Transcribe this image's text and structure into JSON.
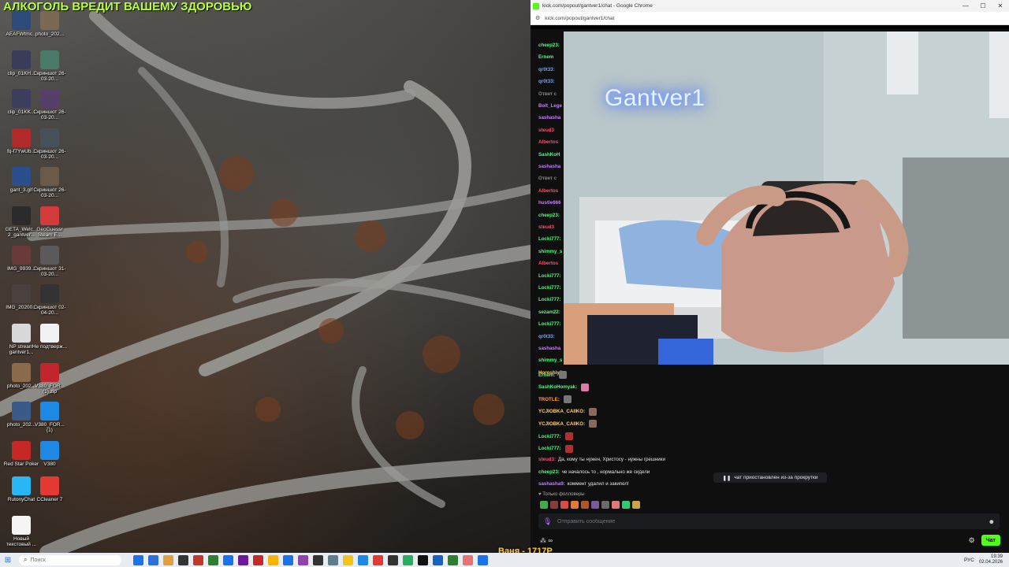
{
  "desktop": {
    "banner": "АЛКОГОЛЬ ВРЕДИТ ВАШЕМУ ЗДОРОВЬЮ",
    "icons": [
      {
        "label": "AEAFWtmc...",
        "color": "#2c4a7a"
      },
      {
        "label": "photo_202...",
        "color": "#7a6a55"
      },
      {
        "label": "clip_01KH...",
        "color": "#3b3b5a"
      },
      {
        "label": "Скриншот 26-03-20...",
        "color": "#4a7a6a"
      },
      {
        "label": "clip_01KK...",
        "color": "#3d3d5e"
      },
      {
        "label": "Скриншот 26-03-20...",
        "color": "#56406a"
      },
      {
        "label": "fq-f7YwUb...",
        "color": "#b02a2a"
      },
      {
        "label": "Скриншот 26-03-20...",
        "color": "#45505a"
      },
      {
        "label": "gant_3.gif",
        "color": "#2a4f8a"
      },
      {
        "label": "Скриншот 26-03-20...",
        "color": "#6a5a4a"
      },
      {
        "label": "GETA_Welc... 2_gantver...",
        "color": "#2b2b2b"
      },
      {
        "label": "GeoGuessr Steam E...",
        "color": "#d33a3a"
      },
      {
        "label": "IMG_9939...",
        "color": "#6a3a3a"
      },
      {
        "label": "Скриншот 31-03-20...",
        "color": "#5a5a5a"
      },
      {
        "label": "IMG_20200...",
        "color": "#4a4040"
      },
      {
        "label": "Скриншот 02-04-20...",
        "color": "#333333"
      },
      {
        "label": "NP stream gantver1...",
        "color": "#d8d8d8"
      },
      {
        "label": "Не подтверж...",
        "color": "#f2f2f2"
      },
      {
        "label": "photo_202...",
        "color": "#8a6a4a"
      },
      {
        "label": "V380_FOR... (1).zip",
        "color": "#c0262b"
      },
      {
        "label": "photo_202...",
        "color": "#3a5a8a"
      },
      {
        "label": "V380_FOR... (1)",
        "color": "#1e88e5"
      },
      {
        "label": "Red Star Poker",
        "color": "#c62828"
      },
      {
        "label": "V380",
        "color": "#1e88e5"
      },
      {
        "label": "RutonyChat",
        "color": "#29b6f6"
      },
      {
        "label": "CCleaner 7",
        "color": "#e53935"
      },
      {
        "label": "Новый текстовый ...",
        "color": "#f5f5f5"
      }
    ]
  },
  "browser": {
    "window_title": "kick.com/popout/gantver1/chat - Google Chrome",
    "url": "kick.com/popout/gantver1/chat",
    "controls": {
      "minimize": "—",
      "maximize": "☐",
      "close": "✕"
    }
  },
  "stream": {
    "neon_sign": "Gantver1"
  },
  "chat": {
    "hidden_usernames": [
      {
        "name": "cheep23:",
        "color": "#52fb7f"
      },
      {
        "name": "Ernem",
        "color": "#52fb7f"
      },
      {
        "name": "qr0t33:",
        "color": "#6aa6ff"
      },
      {
        "name": "qr0t33:",
        "color": "#6aa6ff"
      },
      {
        "name": "Ответ с",
        "color": "#888888"
      },
      {
        "name": "Bolt_Lege",
        "color": "#c77dff"
      },
      {
        "name": "sashasha",
        "color": "#c77dff"
      },
      {
        "name": "steud3",
        "color": "#ff4d6d"
      },
      {
        "name": "Albertos",
        "color": "#ff4d6d"
      },
      {
        "name": "SashKoH",
        "color": "#52fb7f"
      },
      {
        "name": "sashasha",
        "color": "#c77dff"
      },
      {
        "name": "Ответ с",
        "color": "#888888"
      },
      {
        "name": "Albertos",
        "color": "#ff4d6d"
      },
      {
        "name": "hustle666",
        "color": "#c77dff"
      },
      {
        "name": "cheep23:",
        "color": "#52fb7f"
      },
      {
        "name": "steud3",
        "color": "#ff4d6d"
      },
      {
        "name": "Locki777:",
        "color": "#52fb7f"
      },
      {
        "name": "shimmy_s",
        "color": "#52fb7f"
      },
      {
        "name": "Albertos",
        "color": "#ff4d6d"
      },
      {
        "name": "Locki777:",
        "color": "#52fb7f"
      },
      {
        "name": "Locki777:",
        "color": "#52fb7f"
      },
      {
        "name": "Locki777:",
        "color": "#52fb7f"
      },
      {
        "name": "sezam22:",
        "color": "#52fb7f"
      },
      {
        "name": "Locki777:",
        "color": "#52fb7f"
      },
      {
        "name": "qr0t33:",
        "color": "#6aa6ff"
      },
      {
        "name": "sashasha",
        "color": "#c77dff"
      },
      {
        "name": "shimmy_s",
        "color": "#52fb7f"
      },
      {
        "name": "Horoshiy3",
        "color": "#ffd166"
      }
    ],
    "messages": [
      {
        "user": "Ernem:",
        "color": "#52fb7f",
        "text": "",
        "emote": "#777777"
      },
      {
        "user": "SashKoHomyak:",
        "color": "#52fb7f",
        "text": "",
        "emote": "#e07aa8"
      },
      {
        "user": "TROTLE:",
        "color": "#ff9f43",
        "text": "",
        "emote": "#777777"
      },
      {
        "user": "YCJIOBKA_CAIIKO:",
        "color": "#ffd166",
        "text": "",
        "emote": "#8a6a5a"
      },
      {
        "user": "YCJIOBKA_CAIIKO:",
        "color": "#ffd166",
        "text": "",
        "emote": "#8a6a5a"
      },
      {
        "user": "Locki777:",
        "color": "#52fb7f",
        "text": "",
        "emote": "#b03030"
      },
      {
        "user": "Locki777:",
        "color": "#52fb7f",
        "text": "",
        "emote": "#b03030"
      },
      {
        "user": "steud3:",
        "color": "#ff4d6d",
        "text": "Да, кому ты нужен, Христосу - нужны грешники",
        "emote": ""
      },
      {
        "user": "cheep23:",
        "color": "#52fb7f",
        "text": "че началось то , нормально же сидели",
        "emote": ""
      },
      {
        "user": "sashasha9:",
        "color": "#c77dff",
        "text": "коммент удалил и закипел!",
        "emote": ""
      }
    ],
    "paused_notice": "чат приостановлен из-за прокрутки",
    "followers_only": "Только фолловеры",
    "emote_bar_colors": [
      "#3fae49",
      "#8a3a3a",
      "#d94b4b",
      "#e07a3a",
      "#b0562a",
      "#7a5a9a",
      "#6a6a6a",
      "#e07a7a",
      "#2ecc71",
      "#caa34a"
    ],
    "input_placeholder": "Отправить сообщение",
    "infinity": "∞",
    "chat_button": "Чат"
  },
  "taskbar": {
    "search_placeholder": "Поиск",
    "app_colors": [
      "#1a73e8",
      "#2f6fd6",
      "#e0a040",
      "#333333",
      "#c0392b",
      "#2e7d32",
      "#1a73e8",
      "#6a1b9a",
      "#c62828",
      "#f4b400",
      "#1a73e8",
      "#8e44ad",
      "#333333",
      "#607d8b",
      "#f0c419",
      "#1e88e5",
      "#e53935",
      "#333333",
      "#27ae60",
      "#111111",
      "#1565c0",
      "#2e7d32",
      "#e57373",
      "#1a73e8"
    ],
    "donation": "Ваня - 1717Р",
    "language": "РУС",
    "time": "19:39",
    "date": "02.04.2026"
  }
}
